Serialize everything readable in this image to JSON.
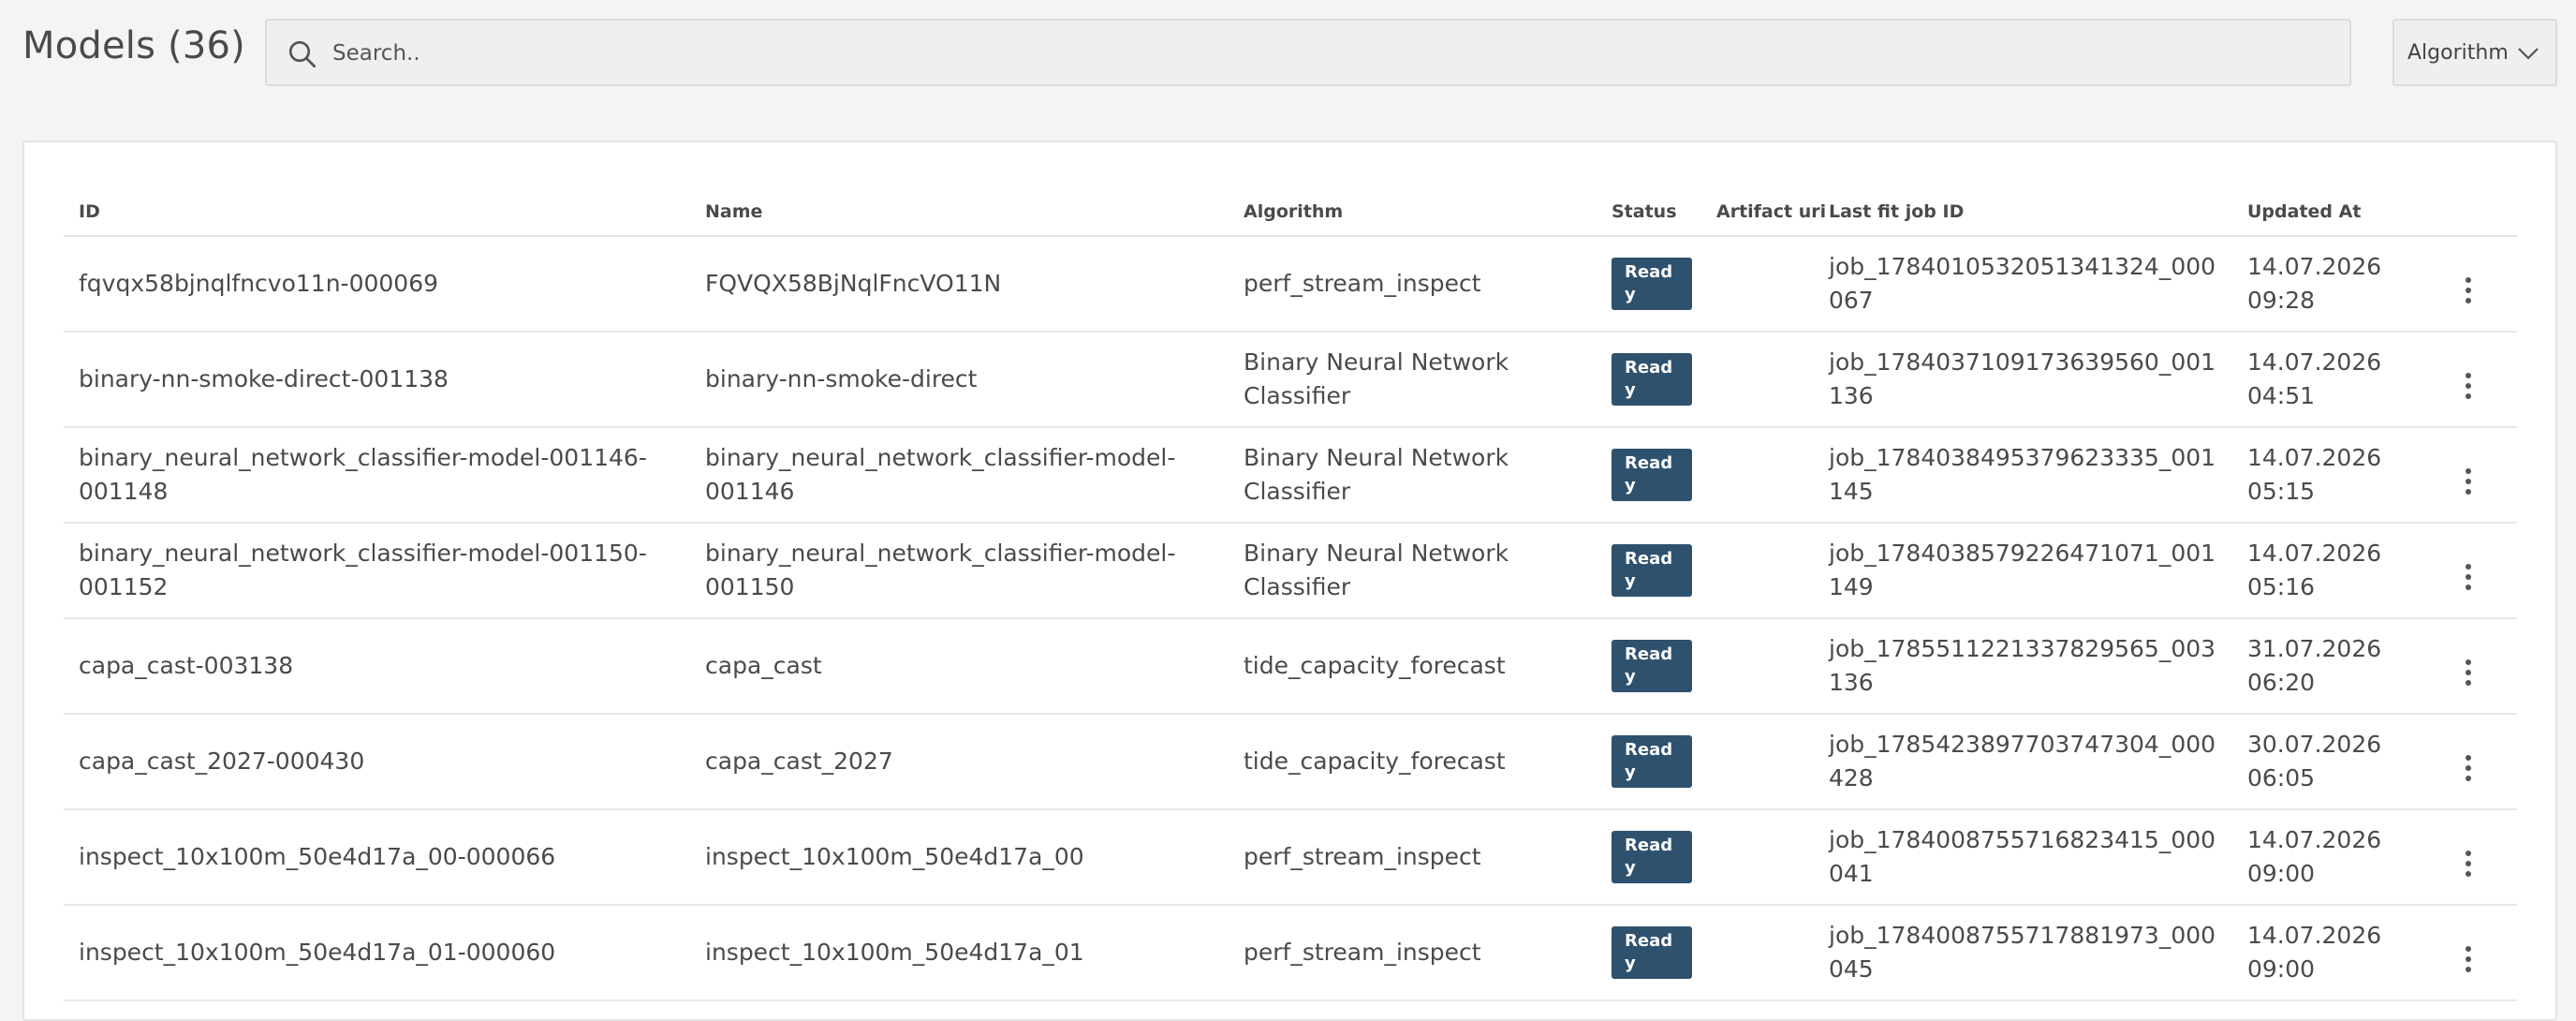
{
  "header": {
    "title": "Models (36)",
    "search_placeholder": "Search..",
    "algorithm_filter_label": "Algorithm"
  },
  "table": {
    "columns": [
      "ID",
      "Name",
      "Algorithm",
      "Status",
      "Artifact uri",
      "Last fit job ID",
      "Updated At"
    ],
    "rows": [
      {
        "id": "fqvqx58bjnqlfncvo11n-000069",
        "name": "FQVQX58BjNqlFncVO11N",
        "algorithm": "perf_stream_inspect",
        "status": "Ready",
        "artifact_uri": "",
        "last_fit_job_id": "job_1784010532051341324_000067",
        "updated_at": "14.07.2026 09:28"
      },
      {
        "id": "binary-nn-smoke-direct-001138",
        "name": "binary-nn-smoke-direct",
        "algorithm": "Binary Neural Network Classifier",
        "status": "Ready",
        "artifact_uri": "",
        "last_fit_job_id": "job_1784037109173639560_001136",
        "updated_at": "14.07.2026 04:51"
      },
      {
        "id": "binary_neural_network_classifier-model-001146-001148",
        "name": "binary_neural_network_classifier-model-001146",
        "algorithm": "Binary Neural Network Classifier",
        "status": "Ready",
        "artifact_uri": "",
        "last_fit_job_id": "job_1784038495379623335_001145",
        "updated_at": "14.07.2026 05:15"
      },
      {
        "id": "binary_neural_network_classifier-model-001150-001152",
        "name": "binary_neural_network_classifier-model-001150",
        "algorithm": "Binary Neural Network Classifier",
        "status": "Ready",
        "artifact_uri": "",
        "last_fit_job_id": "job_1784038579226471071_001149",
        "updated_at": "14.07.2026 05:16"
      },
      {
        "id": "capa_cast-003138",
        "name": "capa_cast",
        "algorithm": "tide_capacity_forecast",
        "status": "Ready",
        "artifact_uri": "",
        "last_fit_job_id": "job_1785511221337829565_003136",
        "updated_at": "31.07.2026 06:20"
      },
      {
        "id": "capa_cast_2027-000430",
        "name": "capa_cast_2027",
        "algorithm": "tide_capacity_forecast",
        "status": "Ready",
        "artifact_uri": "",
        "last_fit_job_id": "job_1785423897703747304_000428",
        "updated_at": "30.07.2026 06:05"
      },
      {
        "id": "inspect_10x100m_50e4d17a_00-000066",
        "name": "inspect_10x100m_50e4d17a_00",
        "algorithm": "perf_stream_inspect",
        "status": "Ready",
        "artifact_uri": "",
        "last_fit_job_id": "job_1784008755716823415_000041",
        "updated_at": "14.07.2026 09:00"
      },
      {
        "id": "inspect_10x100m_50e4d17a_01-000060",
        "name": "inspect_10x100m_50e4d17a_01",
        "algorithm": "perf_stream_inspect",
        "status": "Ready",
        "artifact_uri": "",
        "last_fit_job_id": "job_1784008755717881973_000045",
        "updated_at": "14.07.2026 09:00"
      }
    ]
  },
  "icons": {
    "search": "search-icon",
    "dropdown": "chevron-down-icon",
    "row_menu": "kebab-menu-icon"
  },
  "colors": {
    "status_ready_bg": "#2e516e",
    "page_bg": "#f4f4f4",
    "card_bg": "#ffffff"
  }
}
